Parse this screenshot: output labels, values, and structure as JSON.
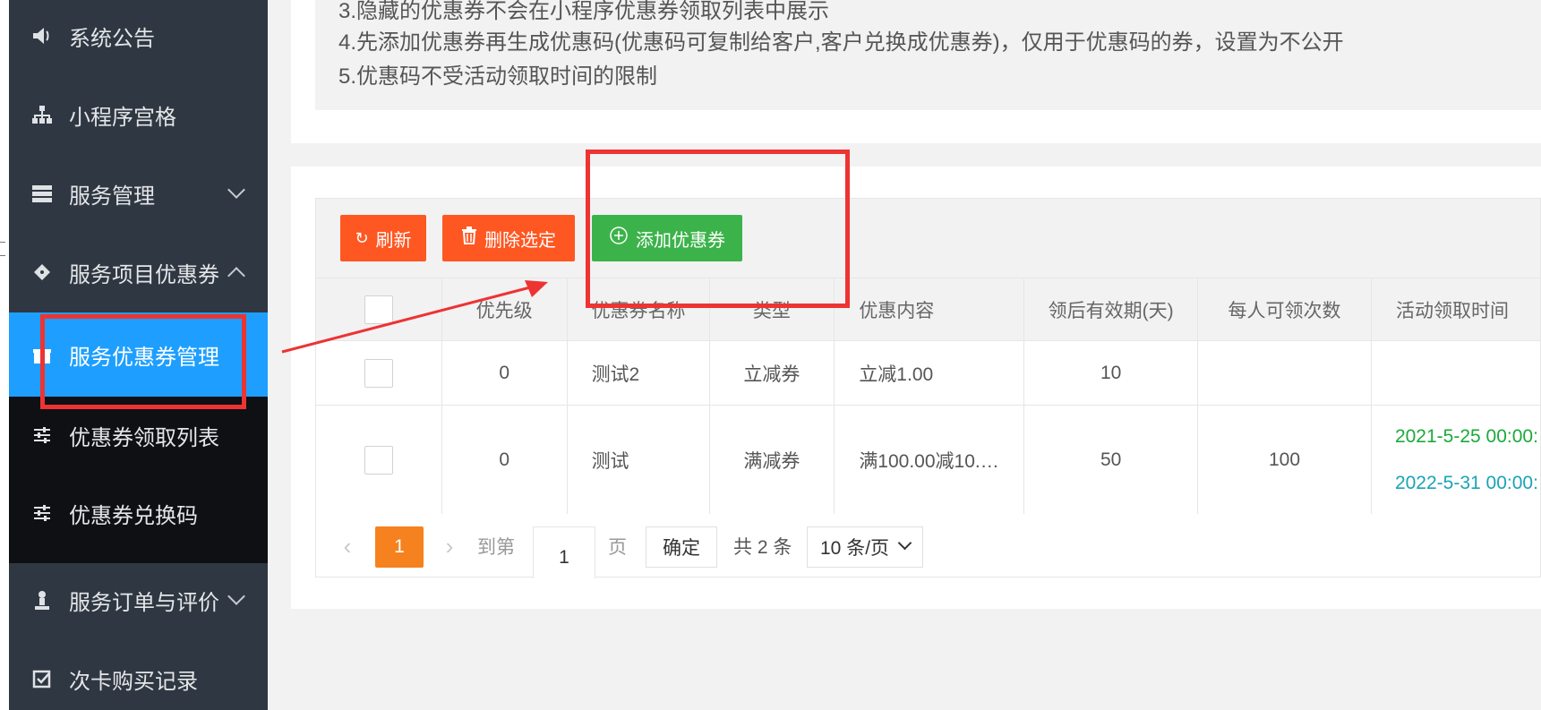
{
  "sidebar": {
    "items": [
      {
        "label": "系统公告",
        "icon": "speaker-icon"
      },
      {
        "label": "小程序宫格",
        "icon": "sitemap-icon"
      },
      {
        "label": "服务管理",
        "icon": "server-icon"
      },
      {
        "label": "服务项目优惠券",
        "icon": "ticket-icon"
      },
      {
        "label": "服务优惠券管理",
        "icon": "gift-icon"
      },
      {
        "label": "优惠券领取列表",
        "icon": "sliders-icon"
      },
      {
        "label": "优惠券兑换码",
        "icon": "sliders-icon"
      },
      {
        "label": "服务订单与评价",
        "icon": "user-icon"
      },
      {
        "label": "次卡购买记录",
        "icon": "checkbox-icon"
      }
    ]
  },
  "notice": {
    "line3": "3.隐藏的优惠券不会在小程序优惠券领取列表中展示",
    "line4": "4.先添加优惠券再生成优惠码(优惠码可复制给客户,客户兑换成优惠券)，仅用于优惠码的券，设置为不公开",
    "line5": "5.优惠码不受活动领取时间的限制"
  },
  "toolbar": {
    "refresh_label": "刷新",
    "delete_label": "删除选定",
    "add_label": "添加优惠券"
  },
  "table": {
    "headers": [
      "优先级",
      "优惠券名称",
      "类型",
      "优惠内容",
      "领后有效期(天)",
      "每人可领次数",
      "活动领取时间"
    ],
    "rows": [
      {
        "priority": "0",
        "name": "测试2",
        "type": "立减券",
        "content": "立减1.00",
        "validity": "10",
        "per_person": "",
        "time_start": "",
        "time_end": ""
      },
      {
        "priority": "0",
        "name": "测试",
        "type": "满减券",
        "content": "满100.00减10.…",
        "validity": "50",
        "per_person": "100",
        "time_start": "2021-5-25 00:00:",
        "time_end": "2022-5-31 00:00:"
      }
    ]
  },
  "pager": {
    "current_page": "1",
    "goto_label": "到第",
    "goto_value": "1",
    "page_label": "页",
    "confirm_label": "确定",
    "total_label": "共 2 条",
    "page_size": "10 条/页"
  },
  "colors": {
    "sidebar_bg": "#2f3742",
    "active": "#1e9fff",
    "orange": "#ff5722",
    "green": "#3cb34a",
    "annotation": "#ee3333"
  }
}
